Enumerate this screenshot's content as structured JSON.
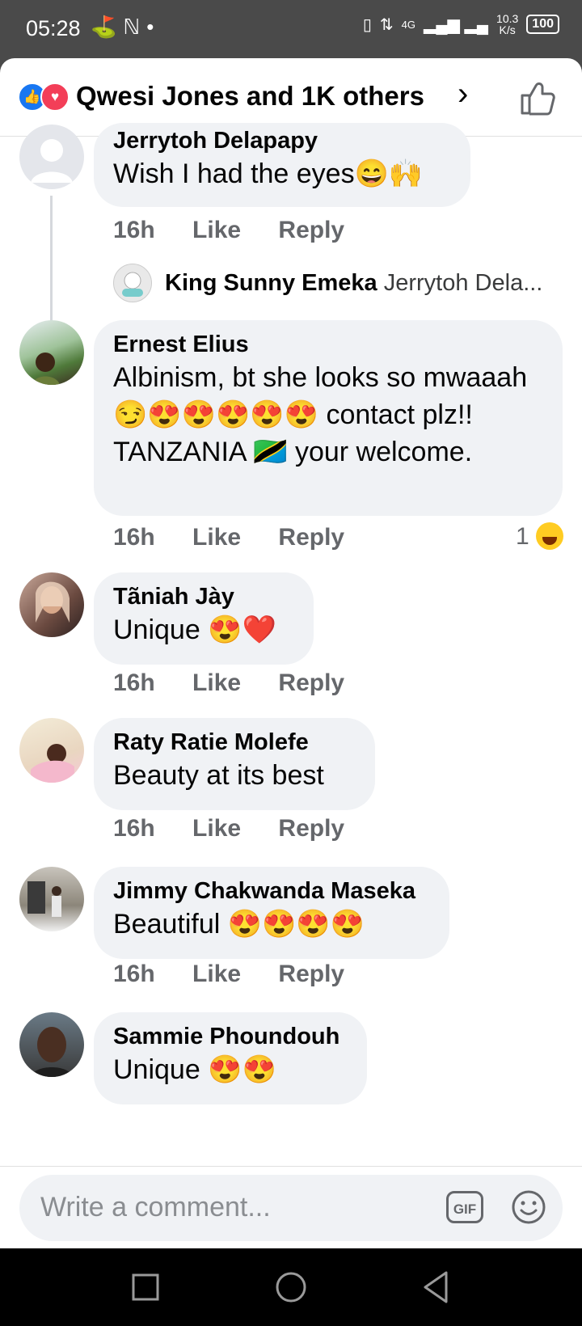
{
  "status_bar": {
    "time": "05:28",
    "network": "4G",
    "speed_value": "10.3",
    "speed_unit": "K/s",
    "battery": "100"
  },
  "header": {
    "title": "Qwesi Jones and 1K others",
    "reaction_icons": [
      "like-icon",
      "love-icon"
    ]
  },
  "comments": [
    {
      "author": "Jerrytoh Delapapy",
      "text": "Wish I had the eyes😄🙌",
      "time": "16h",
      "like": "Like",
      "reply": "Reply"
    },
    {
      "reply_author": "King Sunny Emeka",
      "reply_preview": "Jerrytoh Dela..."
    },
    {
      "author": "Ernest Elius",
      "text": "Albinism, bt she looks so mwaaah😏😍😍😍😍😍 contact plz!! TANZANIA 🇹🇿 your welcome.",
      "time": "16h",
      "like": "Like",
      "reply": "Reply",
      "reaction_count": "1"
    },
    {
      "author": "Tãniah Jày",
      "text": "Unique 😍❤️",
      "time": "16h",
      "like": "Like",
      "reply": "Reply"
    },
    {
      "author": "Raty Ratie Molefe",
      "text": "Beauty at its best",
      "time": "16h",
      "like": "Like",
      "reply": "Reply"
    },
    {
      "author": "Jimmy Chakwanda Maseka",
      "text": "Beautiful 😍😍😍😍",
      "time": "16h",
      "like": "Like",
      "reply": "Reply"
    },
    {
      "author": "Sammie Phoundouh",
      "text": "Unique 😍😍"
    }
  ],
  "composer": {
    "placeholder": "Write a comment...",
    "gif_label": "GIF"
  },
  "colors": {
    "brand_blue": "#1877f2",
    "love_red": "#f33e58",
    "bubble_bg": "#f0f2f5",
    "secondary_text": "#65676b"
  }
}
